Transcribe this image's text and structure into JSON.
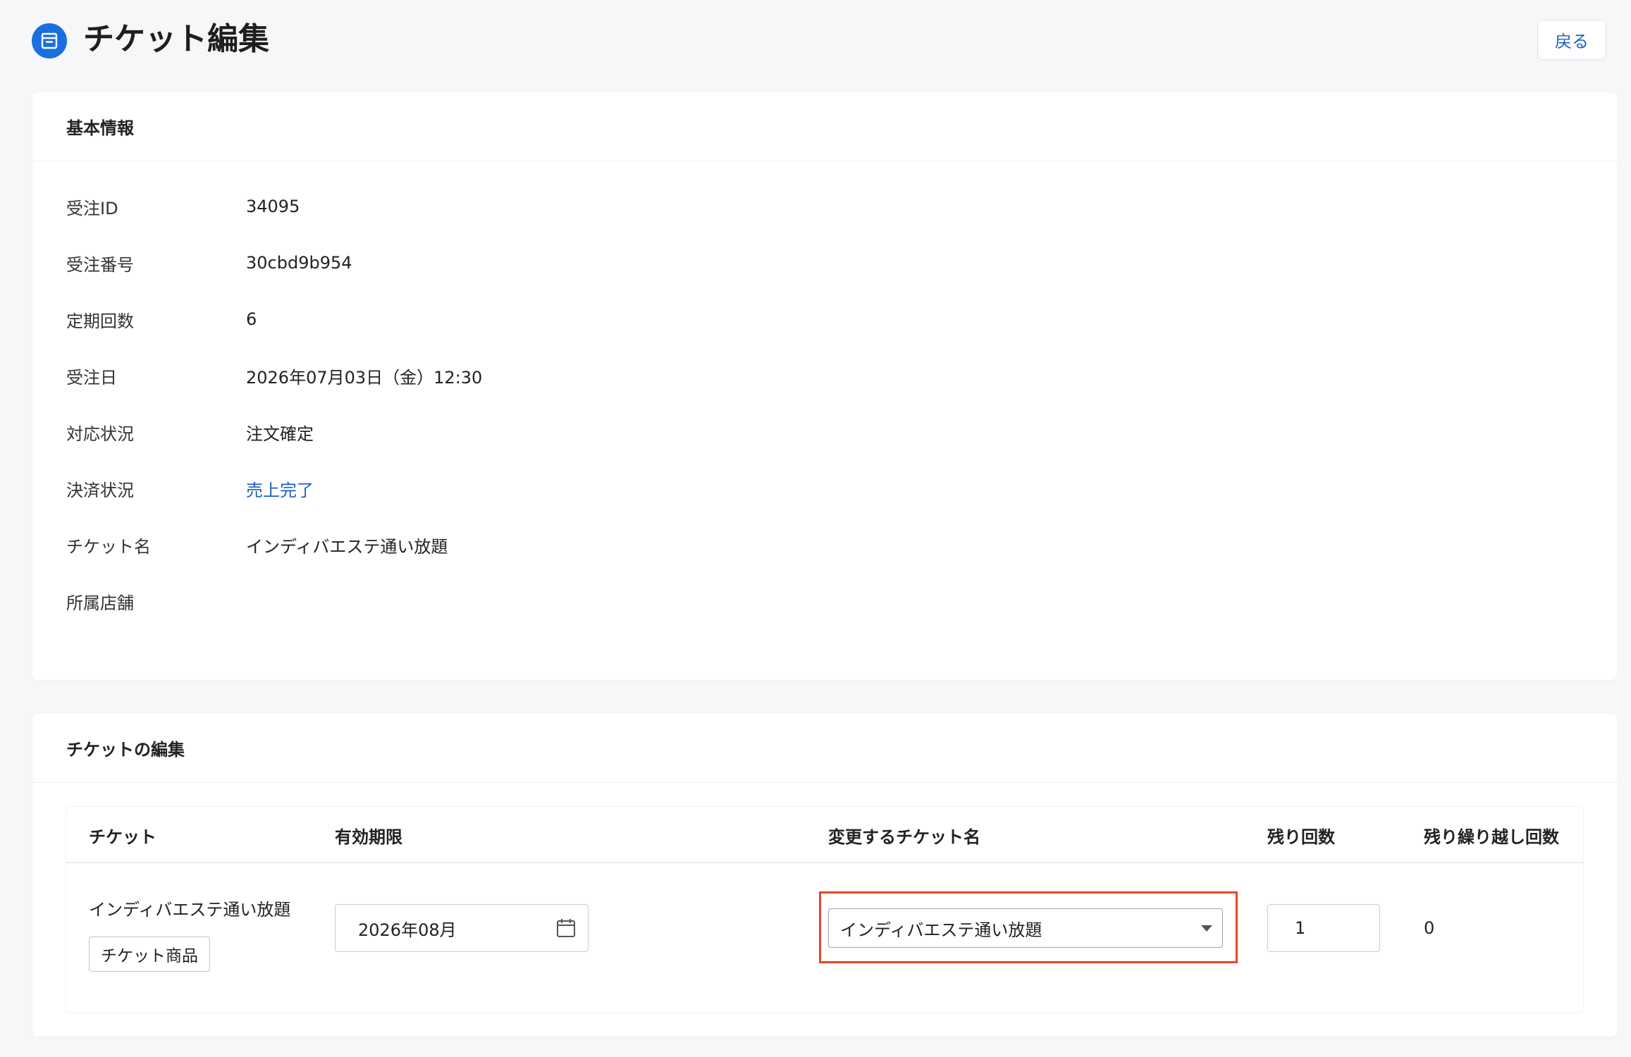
{
  "header": {
    "title": "チケット編集",
    "title_icon": "archive-box-icon",
    "back_label": "戻る"
  },
  "basic_info": {
    "section_title": "基本情報",
    "rows": [
      {
        "label": "受注ID",
        "value": "34095"
      },
      {
        "label": "受注番号",
        "value": "30cbd9b954"
      },
      {
        "label": "定期回数",
        "value": "6"
      },
      {
        "label": "受注日",
        "value": "2026年07月03日（金）12:30"
      },
      {
        "label": "対応状況",
        "value": "注文確定"
      },
      {
        "label": "決済状況",
        "value": "売上完了"
      },
      {
        "label": "チケット名",
        "value": "インディバエステ通い放題"
      },
      {
        "label": "所属店舗",
        "value": ""
      }
    ]
  },
  "ticket_edit": {
    "section_title": "チケットの編集",
    "columns": {
      "ticket": "チケット",
      "expiry": "有効期限",
      "new_ticket_name": "変更するチケット名",
      "remaining": "残り回数",
      "carryover": "残り繰り越し回数"
    },
    "row": {
      "ticket_name": "インディバエステ通い放題",
      "ticket_tag": "チケット商品",
      "expiry_value": "2026年08月",
      "selected_ticket": "インディバエステ通い放題",
      "remaining_value": "1",
      "carryover_value": "0"
    }
  },
  "colors": {
    "accent": "#1a6fe0",
    "link": "#1a5fc4",
    "highlight_border": "#e4452a",
    "background": "#f6f7f9"
  }
}
